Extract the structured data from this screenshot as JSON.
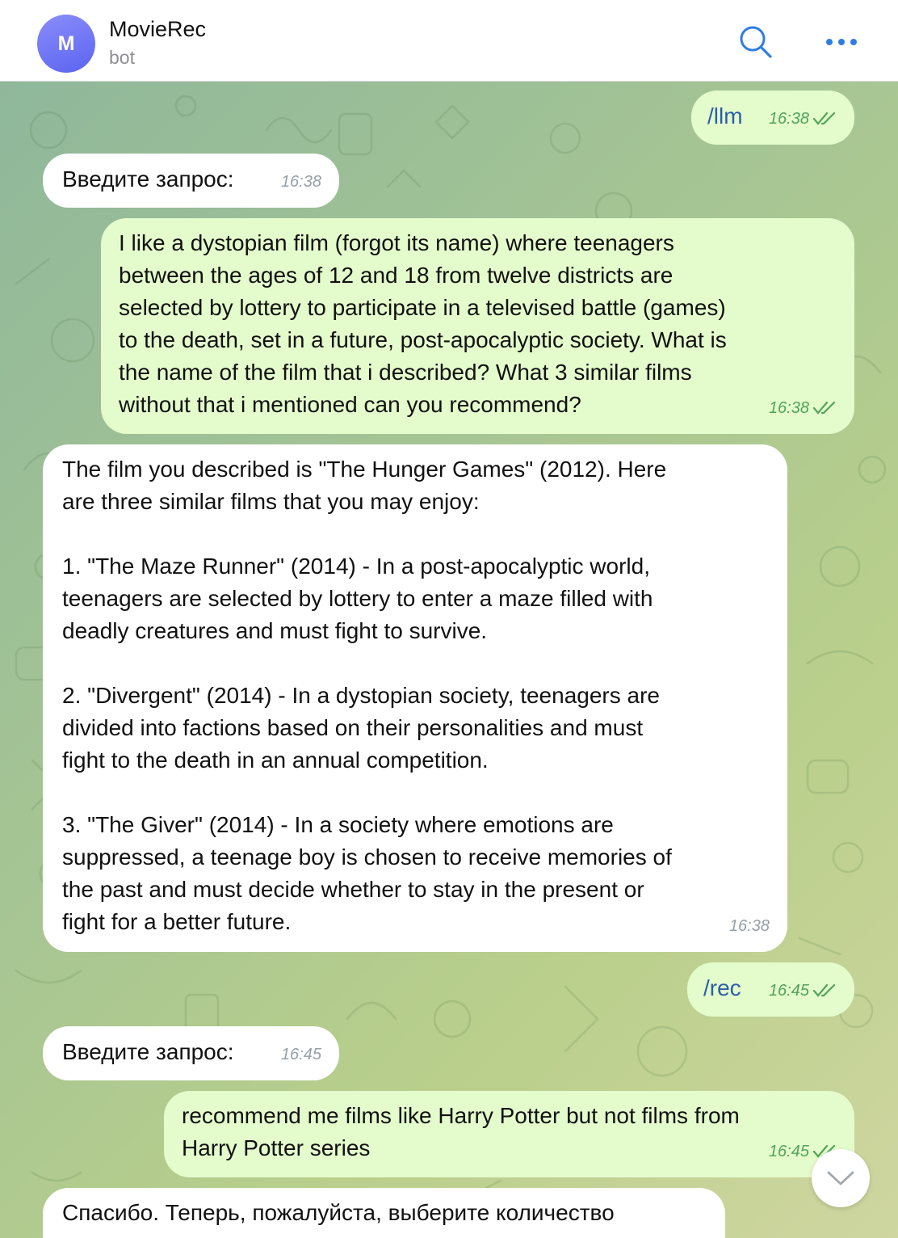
{
  "header": {
    "avatar_letter": "M",
    "title": "MovieRec",
    "subtitle": "bot",
    "search_icon": "search-icon",
    "more_icon": "ellipsis-icon",
    "accent_color": "#2f7de1"
  },
  "messages": [
    {
      "direction": "out",
      "text": "/llm",
      "time": "16:38",
      "read": true
    },
    {
      "direction": "in",
      "text": "Введите запрос:",
      "time": "16:38"
    },
    {
      "direction": "out",
      "text": "I like a dystopian film (forgot its name) where teenagers\nbetween the ages of 12 and 18 from twelve districts are\nselected by lottery to participate in a televised battle (games)\nto the death, set in a future, post-apocalyptic society. What is\nthe name of the film that i described? What 3 similar films\nwithout that i mentioned can you recommend?",
      "time": "16:38",
      "read": true
    },
    {
      "direction": "in",
      "text": "The film you described is \"The Hunger Games\" (2012). Here\nare three similar films that you may enjoy:\n\n1. \"The Maze Runner\" (2014) - In a post-apocalyptic world,\nteenagers are selected by lottery to enter a maze filled with\ndeadly creatures and must fight to survive.\n\n2. \"Divergent\" (2014) - In a dystopian society, teenagers are\ndivided into factions based on their personalities and must\nfight to the death in an annual competition.\n\n3. \"The Giver\" (2014) - In a society where emotions are\nsuppressed, a teenage boy is chosen to receive memories of\nthe past and must decide whether to stay in the present or\nfight for a better future.",
      "time": "16:38"
    },
    {
      "direction": "out",
      "text": "/rec",
      "time": "16:45",
      "read": true
    },
    {
      "direction": "in",
      "text": "Введите запрос:",
      "time": "16:45"
    },
    {
      "direction": "out",
      "text": "recommend me films like Harry Potter but not films from\nHarry Potter series",
      "time": "16:45",
      "read": true
    },
    {
      "direction": "in",
      "text": "Спасибо. Теперь, пожалуйста, выберите количество",
      "time": ""
    }
  ],
  "scroll_down_icon": "chevron-down-icon",
  "colors": {
    "incoming_bubble": "#ffffff",
    "outgoing_bubble": "#e4fbcc",
    "outgoing_time": "#52a45a",
    "incoming_time": "#97a0a6",
    "command_link": "#2a5fa8"
  }
}
